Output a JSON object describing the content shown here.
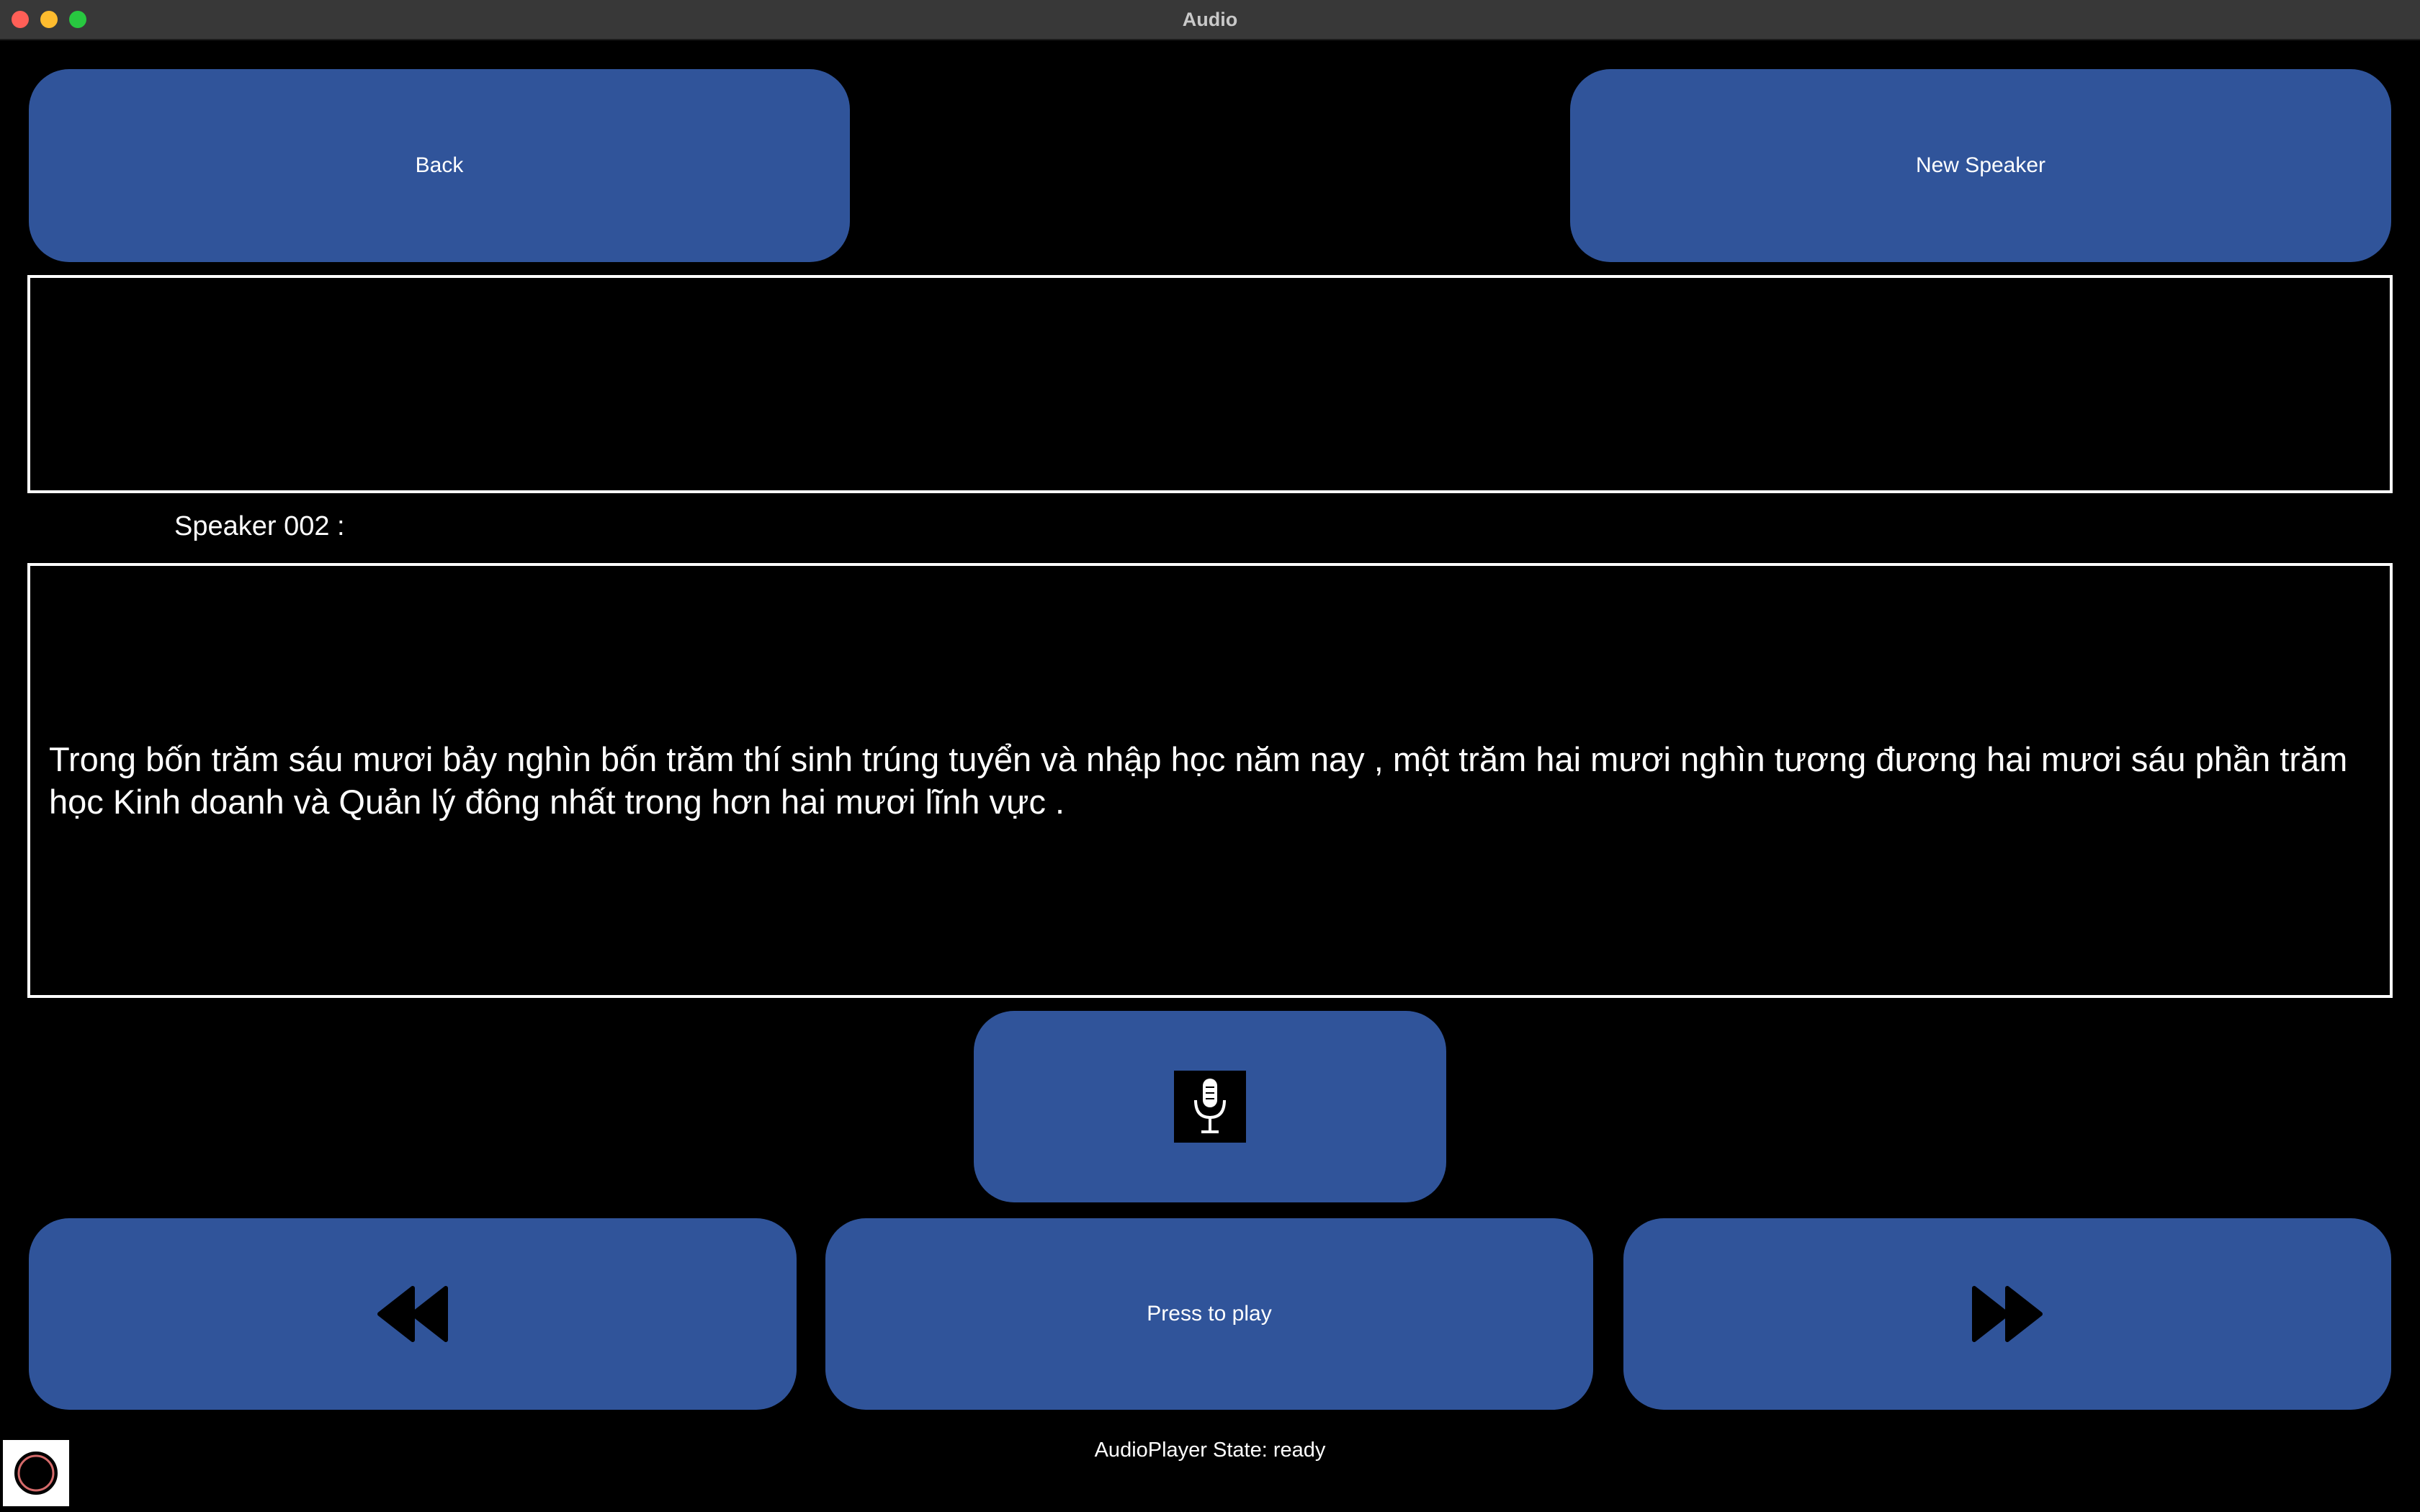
{
  "window": {
    "title": "Audio"
  },
  "top_buttons": {
    "back_label": "Back",
    "new_speaker_label": "New Speaker"
  },
  "speaker": {
    "label": "Speaker 002 :"
  },
  "transcript": {
    "text": "Trong bốn trăm sáu mươi bảy nghìn bốn trăm thí sinh trúng tuyển và nhập học năm nay , một trăm hai mươi nghìn tương đương hai mươi sáu phần trăm học Kinh doanh và Quản lý đông nhất trong hơn hai mươi lĩnh vực ."
  },
  "controls": {
    "record_icon": "microphone-icon",
    "rewind_icon": "rewind-icon",
    "play_label": "Press to play",
    "forward_icon": "fast-forward-icon"
  },
  "status": {
    "text": "AudioPlayer State: ready"
  },
  "colors": {
    "button": "#30549a",
    "background": "#000000",
    "text": "#ffffff"
  }
}
